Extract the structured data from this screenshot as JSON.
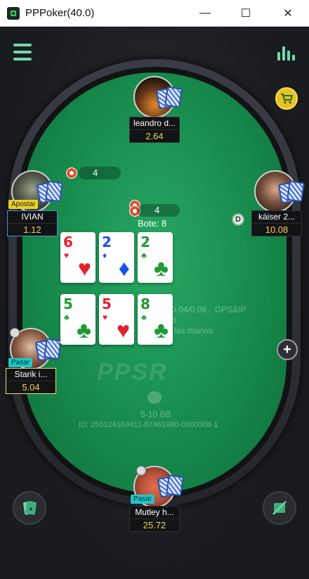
{
  "window": {
    "title": "PPPoker(40.0)",
    "minimize_glyph": "—",
    "maximize_glyph": "☐",
    "close_glyph": "✕"
  },
  "toolbar": {
    "menu_icon": "hamburger-icon",
    "stats_icon": "bar-chart-icon",
    "cart_icon": "shopping-cart-icon"
  },
  "players": {
    "leandro": {
      "name": "leandro d...",
      "stack": "2.64"
    },
    "ivian": {
      "name": "IVIAN",
      "stack": "1.12",
      "action": "Apostar",
      "bet": "4"
    },
    "kaiser": {
      "name": "káiser 2...",
      "stack": "10.08"
    },
    "starik": {
      "name": "Starik i...",
      "stack": "5.04",
      "action": "Pasar"
    },
    "mutley": {
      "name": "Mutley h...",
      "stack": "25.72",
      "action": "Pasar"
    }
  },
  "pot": {
    "bet_amount": "4",
    "label": "Bote: 8"
  },
  "dealer": {
    "label": "D"
  },
  "community_cards": [
    {
      "rank": "6",
      "suit": "♥",
      "color": "#e0212c"
    },
    {
      "rank": "2",
      "suit": "♦",
      "color": "#1a52e8"
    },
    {
      "rank": "2",
      "suit": "♣",
      "color": "#1f9a34"
    },
    {
      "rank": "5",
      "suit": "♣",
      "color": "#1f9a34"
    },
    {
      "rank": "5",
      "suit": "♥",
      "color": "#e0212c"
    },
    {
      "rank": "8",
      "suit": "♣",
      "color": "#1f9a34"
    }
  ],
  "table_info": {
    "blinds_text": "0.04/0.08",
    "gps_text": "GPS&IP",
    "line_d": "d",
    "hands_text": "las manos",
    "watermark": "PPSR",
    "bb_text": "5-10 BB",
    "id_text": "ID: 250126103411-87461980-0000308-1"
  },
  "colors": {
    "felt": "#178a4c",
    "accent": "#6fd9a8",
    "stack": "#f2d24a"
  }
}
